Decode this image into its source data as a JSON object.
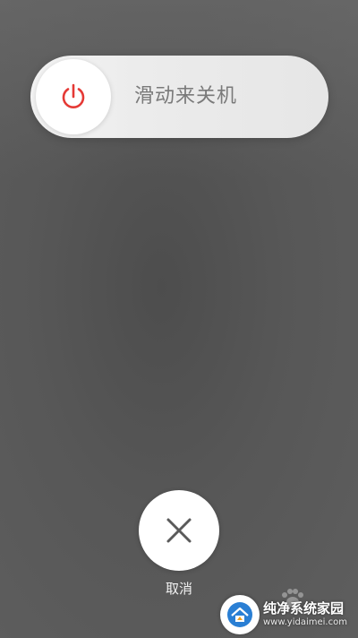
{
  "slider": {
    "label": "滑动来关机"
  },
  "cancel": {
    "label": "取消"
  },
  "watermark": {
    "title": "纯净系统家园",
    "url": "www.yidaimei.com"
  },
  "colors": {
    "power_icon": "#e53935",
    "close_icon": "#5a5a5a",
    "background": "#555555"
  },
  "icons": {
    "power": "power-icon",
    "close": "close-icon",
    "logo": "house-logo-icon",
    "paw": "paw-icon"
  }
}
